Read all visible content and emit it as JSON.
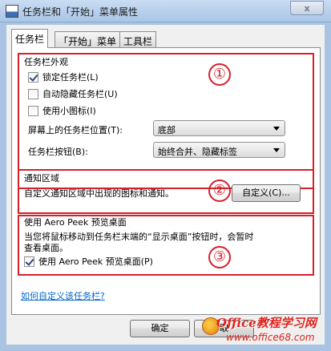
{
  "window": {
    "title": "任务栏和「开始」菜单属性",
    "close_label": "x"
  },
  "tabs": [
    {
      "label": "任务栏",
      "active": true
    },
    {
      "label": "「开始」菜单",
      "active": false
    },
    {
      "label": "工具栏",
      "active": false
    }
  ],
  "appearance": {
    "title": "任务栏外观",
    "lock_taskbar": {
      "label": "锁定任务栏(L)",
      "checked": true
    },
    "auto_hide": {
      "label": "自动隐藏任务栏(U)",
      "checked": false
    },
    "small_icons": {
      "label": "使用小图标(I)",
      "checked": false
    },
    "position_label": "屏幕上的任务栏位置(T):",
    "position_value": "底部",
    "buttons_label": "任务栏按钮(B):",
    "buttons_value": "始终合并、隐藏标签"
  },
  "notification": {
    "title": "通知区域",
    "description": "自定义通知区域中出现的图标和通知。",
    "customize_button": "自定义(C)..."
  },
  "aero_peek": {
    "title": "使用 Aero Peek 预览桌面",
    "description_line1": "当您将鼠标移动到任务栏末端的“显示桌面”按钮时，会暂时",
    "description_line2": "查看桌面。",
    "checkbox": {
      "label": "使用 Aero Peek 预览桌面(P)",
      "checked": true
    }
  },
  "help_link": "如何自定义该任务栏?",
  "buttons": {
    "ok": "确定",
    "cancel": "取"
  },
  "annotations": {
    "one": "①",
    "two": "②",
    "three": "③"
  },
  "watermark": {
    "line1": "Office教程学习网",
    "line2": "www.office68.com"
  },
  "colors": {
    "annotation_red": "#d6202a",
    "link_blue": "#0066cc",
    "frame_blue": "#a9c3e3"
  }
}
